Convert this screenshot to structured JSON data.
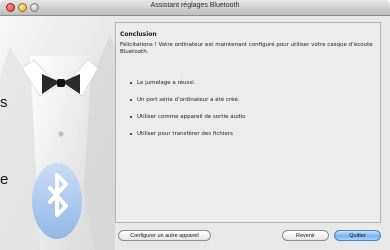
{
  "window": {
    "title": "Assistant réglages Bluetooth"
  },
  "sidebar": {
    "cropped_chars": [
      "s",
      "e"
    ]
  },
  "content": {
    "heading": "Conclusion",
    "intro": "Félicitations ! Votre ordinateur est maintenant configuré pour utiliser votre casque d’écoute Bluetooth.",
    "bullets": [
      "Le jumelage a réussi.",
      "Un port série d’ordinateur a été créé.",
      "Utiliser comme appareil de sortie audio",
      "Utiliser pour transférer des fichiers"
    ]
  },
  "buttons": {
    "configure": "Configurer un autre appareil",
    "back": "Revenir",
    "quit": "Quitter"
  },
  "colors": {
    "accent": "#79b2f2",
    "bluetooth": "#a9c8ef"
  }
}
